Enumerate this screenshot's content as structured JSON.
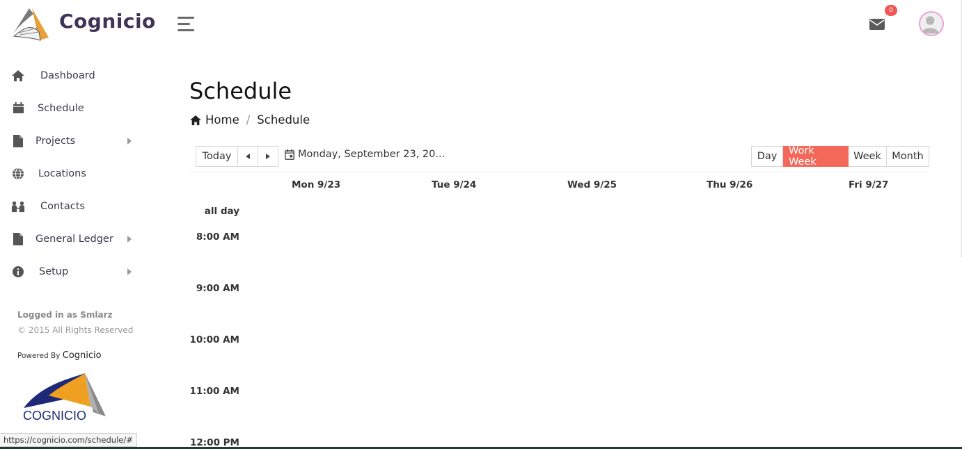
{
  "header": {
    "brand": "Cognicio",
    "mail_badge_count": "0"
  },
  "sidebar": {
    "items": [
      {
        "label": "Dashboard",
        "icon": "home-icon",
        "has_submenu": false
      },
      {
        "label": "Schedule",
        "icon": "calendar-icon",
        "has_submenu": false
      },
      {
        "label": "Projects",
        "icon": "file-icon",
        "has_submenu": true
      },
      {
        "label": "Locations",
        "icon": "globe-icon",
        "has_submenu": false
      },
      {
        "label": "Contacts",
        "icon": "people-icon",
        "has_submenu": false
      },
      {
        "label": "General Ledger",
        "icon": "file-icon",
        "has_submenu": true
      },
      {
        "label": "Setup",
        "icon": "info-icon",
        "has_submenu": true
      }
    ],
    "logged_in": "Logged in as Smlarz",
    "copyright": "© 2015 All Rights Reserved",
    "powered_by": "Powered By",
    "powered_brand": "Cognicio",
    "footer_logo_text": "COGNICIO"
  },
  "main": {
    "title": "Schedule",
    "breadcrumb": {
      "home": "Home",
      "current": "Schedule"
    }
  },
  "calendar": {
    "today_label": "Today",
    "date_label": "Monday, September 23, 20...",
    "views": [
      {
        "label": "Day",
        "active": false
      },
      {
        "label": "Work Week",
        "active": true
      },
      {
        "label": "Week",
        "active": false
      },
      {
        "label": "Month",
        "active": false
      }
    ],
    "days": [
      "Mon 9/23",
      "Tue 9/24",
      "Wed 9/25",
      "Thu 9/26",
      "Fri 9/27"
    ],
    "all_day_label": "all day",
    "times": [
      "8:00 AM",
      "9:00 AM",
      "10:00 AM",
      "11:00 AM",
      "12:00 PM"
    ]
  },
  "status_url": "https://cognicio.com/schedule/#",
  "colors": {
    "accent": "#f4685a",
    "brand": "#3d3458",
    "badge": "#f05656"
  }
}
